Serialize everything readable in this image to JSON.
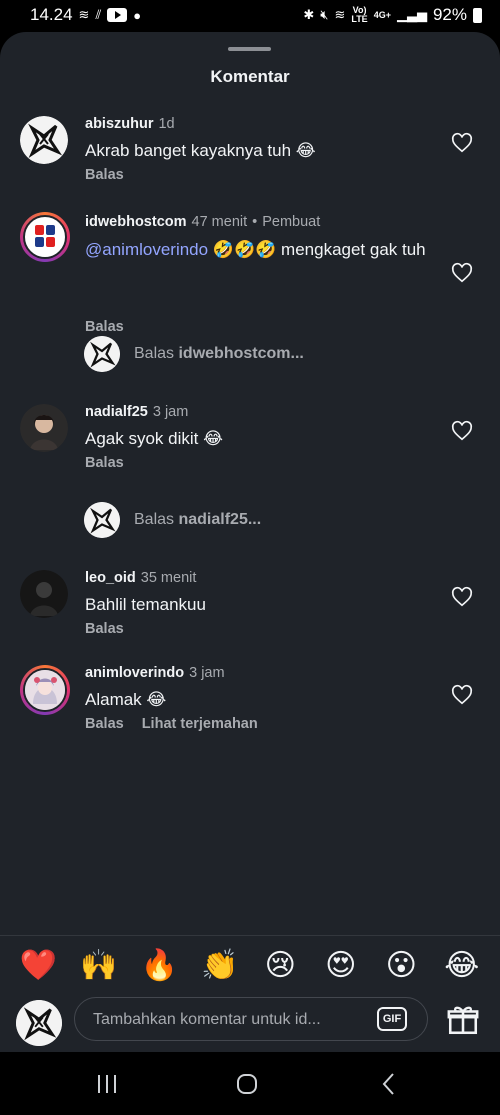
{
  "status_bar": {
    "time": "14.24",
    "battery": "92%",
    "network": "4G+",
    "lte": "LTE",
    "volte": "Vo)"
  },
  "sheet": {
    "title": "Komentar"
  },
  "comments": [
    {
      "username": "abiszuhur",
      "time": "1d",
      "text": "Akrab banget kayaknya tuh 😂",
      "reply": "Balas"
    },
    {
      "username": "idwebhostcom",
      "time": "47 menit",
      "badge": "Pembuat",
      "mention": "@animloverindo",
      "text": " 🤣🤣🤣 mengkaget gak tuh",
      "reply": "Balas",
      "replies_preview": {
        "prefix": "Balas",
        "user": "idwebhostcom..."
      }
    },
    {
      "username": "nadialf25",
      "time": "3 jam",
      "text": "Agak syok dikit 😂",
      "reply": "Balas",
      "replies_preview": {
        "prefix": "Balas",
        "user": "nadialf25..."
      }
    },
    {
      "username": "leo_oid",
      "time": "35 menit",
      "text": "Bahlil temankuu",
      "reply": "Balas"
    },
    {
      "username": "animloverindo",
      "time": "3 jam",
      "text": "Alamak 😂",
      "reply": "Balas",
      "translate": "Lihat terjemahan"
    }
  ],
  "emoji_bar": [
    "❤️",
    "🙌",
    "🔥",
    "👏",
    "😢",
    "😍",
    "😮",
    "😂"
  ],
  "composer": {
    "placeholder": "Tambahkan komentar untuk id...",
    "gif_label": "GIF"
  },
  "icons": {
    "heart": "heart-icon",
    "gift": "gift-icon",
    "recents": "recents-icon",
    "home": "home-icon",
    "back": "back-icon"
  },
  "colors": {
    "sheet_bg": "#1f2329",
    "mention": "#93a5ff",
    "secondary_text": "#a8abb0"
  }
}
